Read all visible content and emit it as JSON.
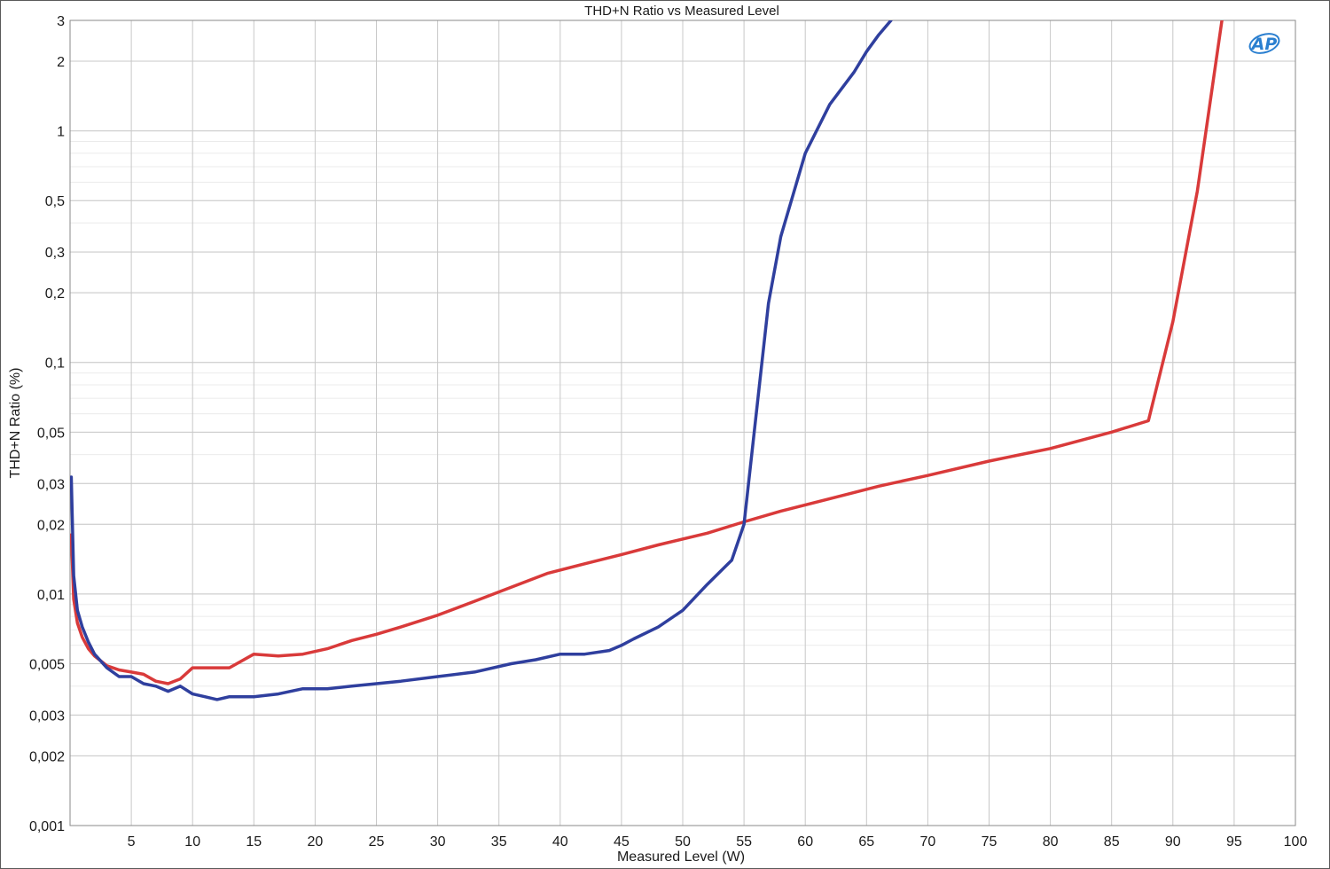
{
  "chart_data": {
    "type": "line",
    "title": "THD+N Ratio vs Measured Level",
    "xlabel": "Measured Level (W)",
    "ylabel": "THD+N Ratio (%)",
    "xlim": [
      0,
      100
    ],
    "ylim": [
      0.001,
      3
    ],
    "yscale": "log",
    "grid": true,
    "logo_text": "AP",
    "x_ticks": [
      5,
      10,
      15,
      20,
      25,
      30,
      35,
      40,
      45,
      50,
      55,
      60,
      65,
      70,
      75,
      80,
      85,
      90,
      95,
      100
    ],
    "x_tick_labels": [
      "5",
      "10",
      "15",
      "20",
      "25",
      "30",
      "35",
      "40",
      "45",
      "50",
      "55",
      "60",
      "65",
      "70",
      "75",
      "80",
      "85",
      "90",
      "95",
      "100"
    ],
    "y_ticks": [
      0.001,
      0.002,
      0.003,
      0.005,
      0.01,
      0.02,
      0.03,
      0.05,
      0.1,
      0.2,
      0.3,
      0.5,
      1,
      2,
      3
    ],
    "y_tick_labels": [
      "0,001",
      "0,002",
      "0,003",
      "0,005",
      "0,01",
      "0,02",
      "0,03",
      "0,05",
      "0,1",
      "0,2",
      "0,3",
      "0,5",
      "1",
      "2",
      "3"
    ],
    "series": [
      {
        "color": "#d93a3a",
        "x": [
          0.1,
          0.3,
          0.6,
          1,
          1.5,
          2,
          3,
          4,
          5,
          6,
          7,
          8,
          9,
          10,
          11,
          12,
          13,
          15,
          17,
          19,
          21,
          23,
          25,
          27,
          30,
          33,
          36,
          39,
          42,
          45,
          48,
          52,
          55,
          58,
          62,
          66,
          70,
          75,
          80,
          85,
          88,
          90,
          92,
          94
        ],
        "y": [
          0.018,
          0.0095,
          0.0075,
          0.0065,
          0.0058,
          0.0054,
          0.0049,
          0.0047,
          0.0046,
          0.0045,
          0.0042,
          0.0041,
          0.0043,
          0.0048,
          0.0048,
          0.0048,
          0.0048,
          0.0055,
          0.0054,
          0.0055,
          0.0058,
          0.0063,
          0.0067,
          0.0072,
          0.0081,
          0.0093,
          0.0107,
          0.0123,
          0.0135,
          0.0148,
          0.0163,
          0.0183,
          0.0205,
          0.0228,
          0.0258,
          0.0292,
          0.0325,
          0.0375,
          0.0425,
          0.05,
          0.056,
          0.15,
          0.55,
          3.0
        ]
      },
      {
        "color": "#2f3f9e",
        "x": [
          0.1,
          0.3,
          0.6,
          1,
          1.5,
          2,
          3,
          4,
          5,
          6,
          7,
          8,
          9,
          10,
          11,
          12,
          13,
          14,
          15,
          17,
          19,
          21,
          23,
          25,
          27,
          30,
          33,
          36,
          38,
          40,
          42,
          44,
          45,
          46,
          48,
          50,
          52,
          54,
          55,
          56,
          57,
          58,
          60,
          62,
          64,
          65,
          66,
          67
        ],
        "y": [
          0.032,
          0.012,
          0.0085,
          0.0072,
          0.0062,
          0.0055,
          0.0048,
          0.0044,
          0.0044,
          0.0041,
          0.004,
          0.0038,
          0.004,
          0.0037,
          0.0036,
          0.0035,
          0.0036,
          0.0036,
          0.0036,
          0.0037,
          0.0039,
          0.0039,
          0.004,
          0.0041,
          0.0042,
          0.0044,
          0.0046,
          0.005,
          0.0052,
          0.0055,
          0.0055,
          0.0057,
          0.006,
          0.0064,
          0.0072,
          0.0085,
          0.011,
          0.014,
          0.02,
          0.06,
          0.18,
          0.35,
          0.8,
          1.3,
          1.8,
          2.2,
          2.6,
          3.0
        ]
      }
    ]
  }
}
